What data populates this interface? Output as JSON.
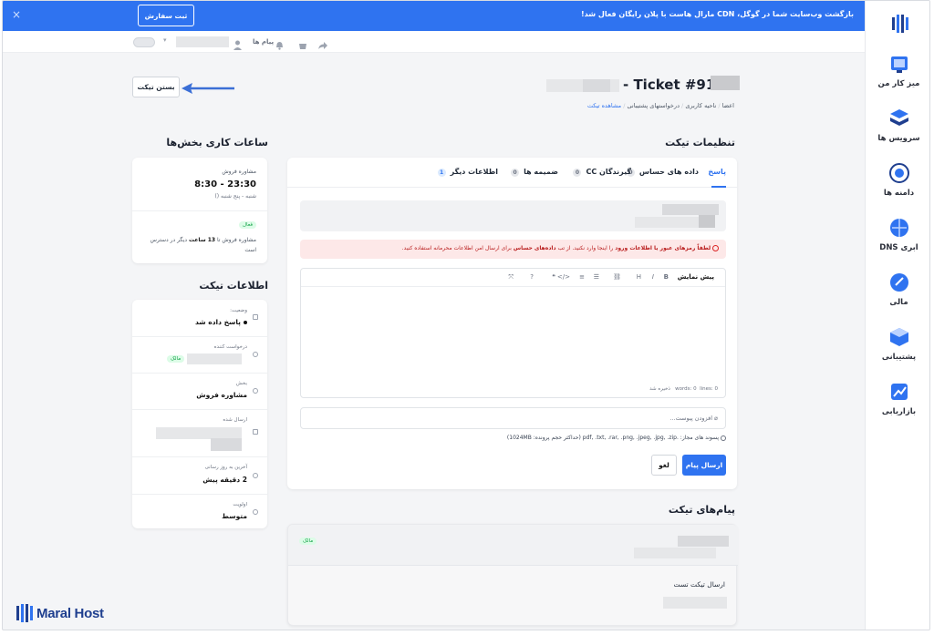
{
  "banner": {
    "message": "بازگشت وب‌سایت شما در گوگل، CDN مارال هاست با پلان رایگان فعال شد!",
    "button_label": "ثبت سفارش",
    "close_icon": "×"
  },
  "topbar": {
    "messages_label": "پیام ها"
  },
  "sidebar": {
    "items": [
      {
        "label": "میز کار من",
        "icon": "dashboard-icon"
      },
      {
        "label": "سرویس ها",
        "icon": "services-icon"
      },
      {
        "label": "دامنه ها",
        "icon": "domains-icon"
      },
      {
        "label": "DNS ابری",
        "icon": "cloud-dns-icon"
      },
      {
        "label": "مالی",
        "icon": "finance-icon"
      },
      {
        "label": "پشتیبانی",
        "icon": "support-icon"
      },
      {
        "label": "بازاریابی",
        "icon": "marketing-icon"
      }
    ]
  },
  "page": {
    "ticket_title": "- Ticket #914",
    "close_ticket_label": "بستن تیکت",
    "breadcrumb": [
      "اعضا",
      "ناحیه کاربری",
      "درخواستهای پشتیبانی",
      "مشاهده تیکت"
    ]
  },
  "ticket_settings": {
    "title": "تنظیمات تیکت",
    "tabs": [
      {
        "label": "پاسخ",
        "count": ""
      },
      {
        "label": "داده های حساس",
        "count": "0"
      },
      {
        "label": "گیرندگان CC",
        "count": "0"
      },
      {
        "label": "ضمیمه ها",
        "count": "0"
      },
      {
        "label": "اطلاعات دیگر",
        "count": "1"
      }
    ],
    "warning_bold": "لطفاً رمزهای عبور یا اطلاعات ورود",
    "warning_text": " را اینجا وارد نکنید. از تب ",
    "warning_bold2": "داده‌های حساس",
    "warning_text2": " برای ارسال امن اطلاعات محرمانه استفاده کنید.",
    "editor_preview_label": "پیش نمایش",
    "editor_status": {
      "words": "words: 0",
      "lines": "lines: 0",
      "saved": "ذخیره شد"
    },
    "add_attachment": "افزودن پیوست...",
    "allowed_ext": "پسوند های مجاز: .pdf, .txt, .rar, .png, .jpeg, .jpg, .zip (حداکثر حجم پرونده: 1024MB)",
    "send_label": "ارسال پیام",
    "cancel_label": "لغو"
  },
  "working_hours": {
    "title": "ساعات کاری بخش‌ها",
    "dept": "مشاوره فروش",
    "hours": "8:30 - 23:30",
    "days": "شنبه - پنج شنبه ()",
    "status_badge": "فعال",
    "availability_prefix": "مشاوره فروش تا ",
    "availability_bold": "13 ساعت",
    "availability_suffix": " دیگر در دسترس است"
  },
  "ticket_info": {
    "title": "اطلاعات تیکت",
    "rows": [
      {
        "label": "وضعیت:",
        "value": "پاسخ داده شد"
      },
      {
        "label": "درخواست کننده",
        "value": "",
        "badge": "مالک"
      },
      {
        "label": "بخش",
        "value": "مشاوره فروش"
      },
      {
        "label": "ارسال شده",
        "value": ""
      },
      {
        "label": "آخرین به روز رسانی",
        "value": "2 دقیقه پیش"
      },
      {
        "label": "اولویت",
        "value": "متوسط"
      }
    ]
  },
  "ticket_messages": {
    "title": "پیام‌های تیکت",
    "owner_badge": "مالک",
    "message_text": "ارسال تیکت تست"
  },
  "brand": {
    "logo_text": "Maral Host",
    "color_primary": "#2f73f0"
  }
}
